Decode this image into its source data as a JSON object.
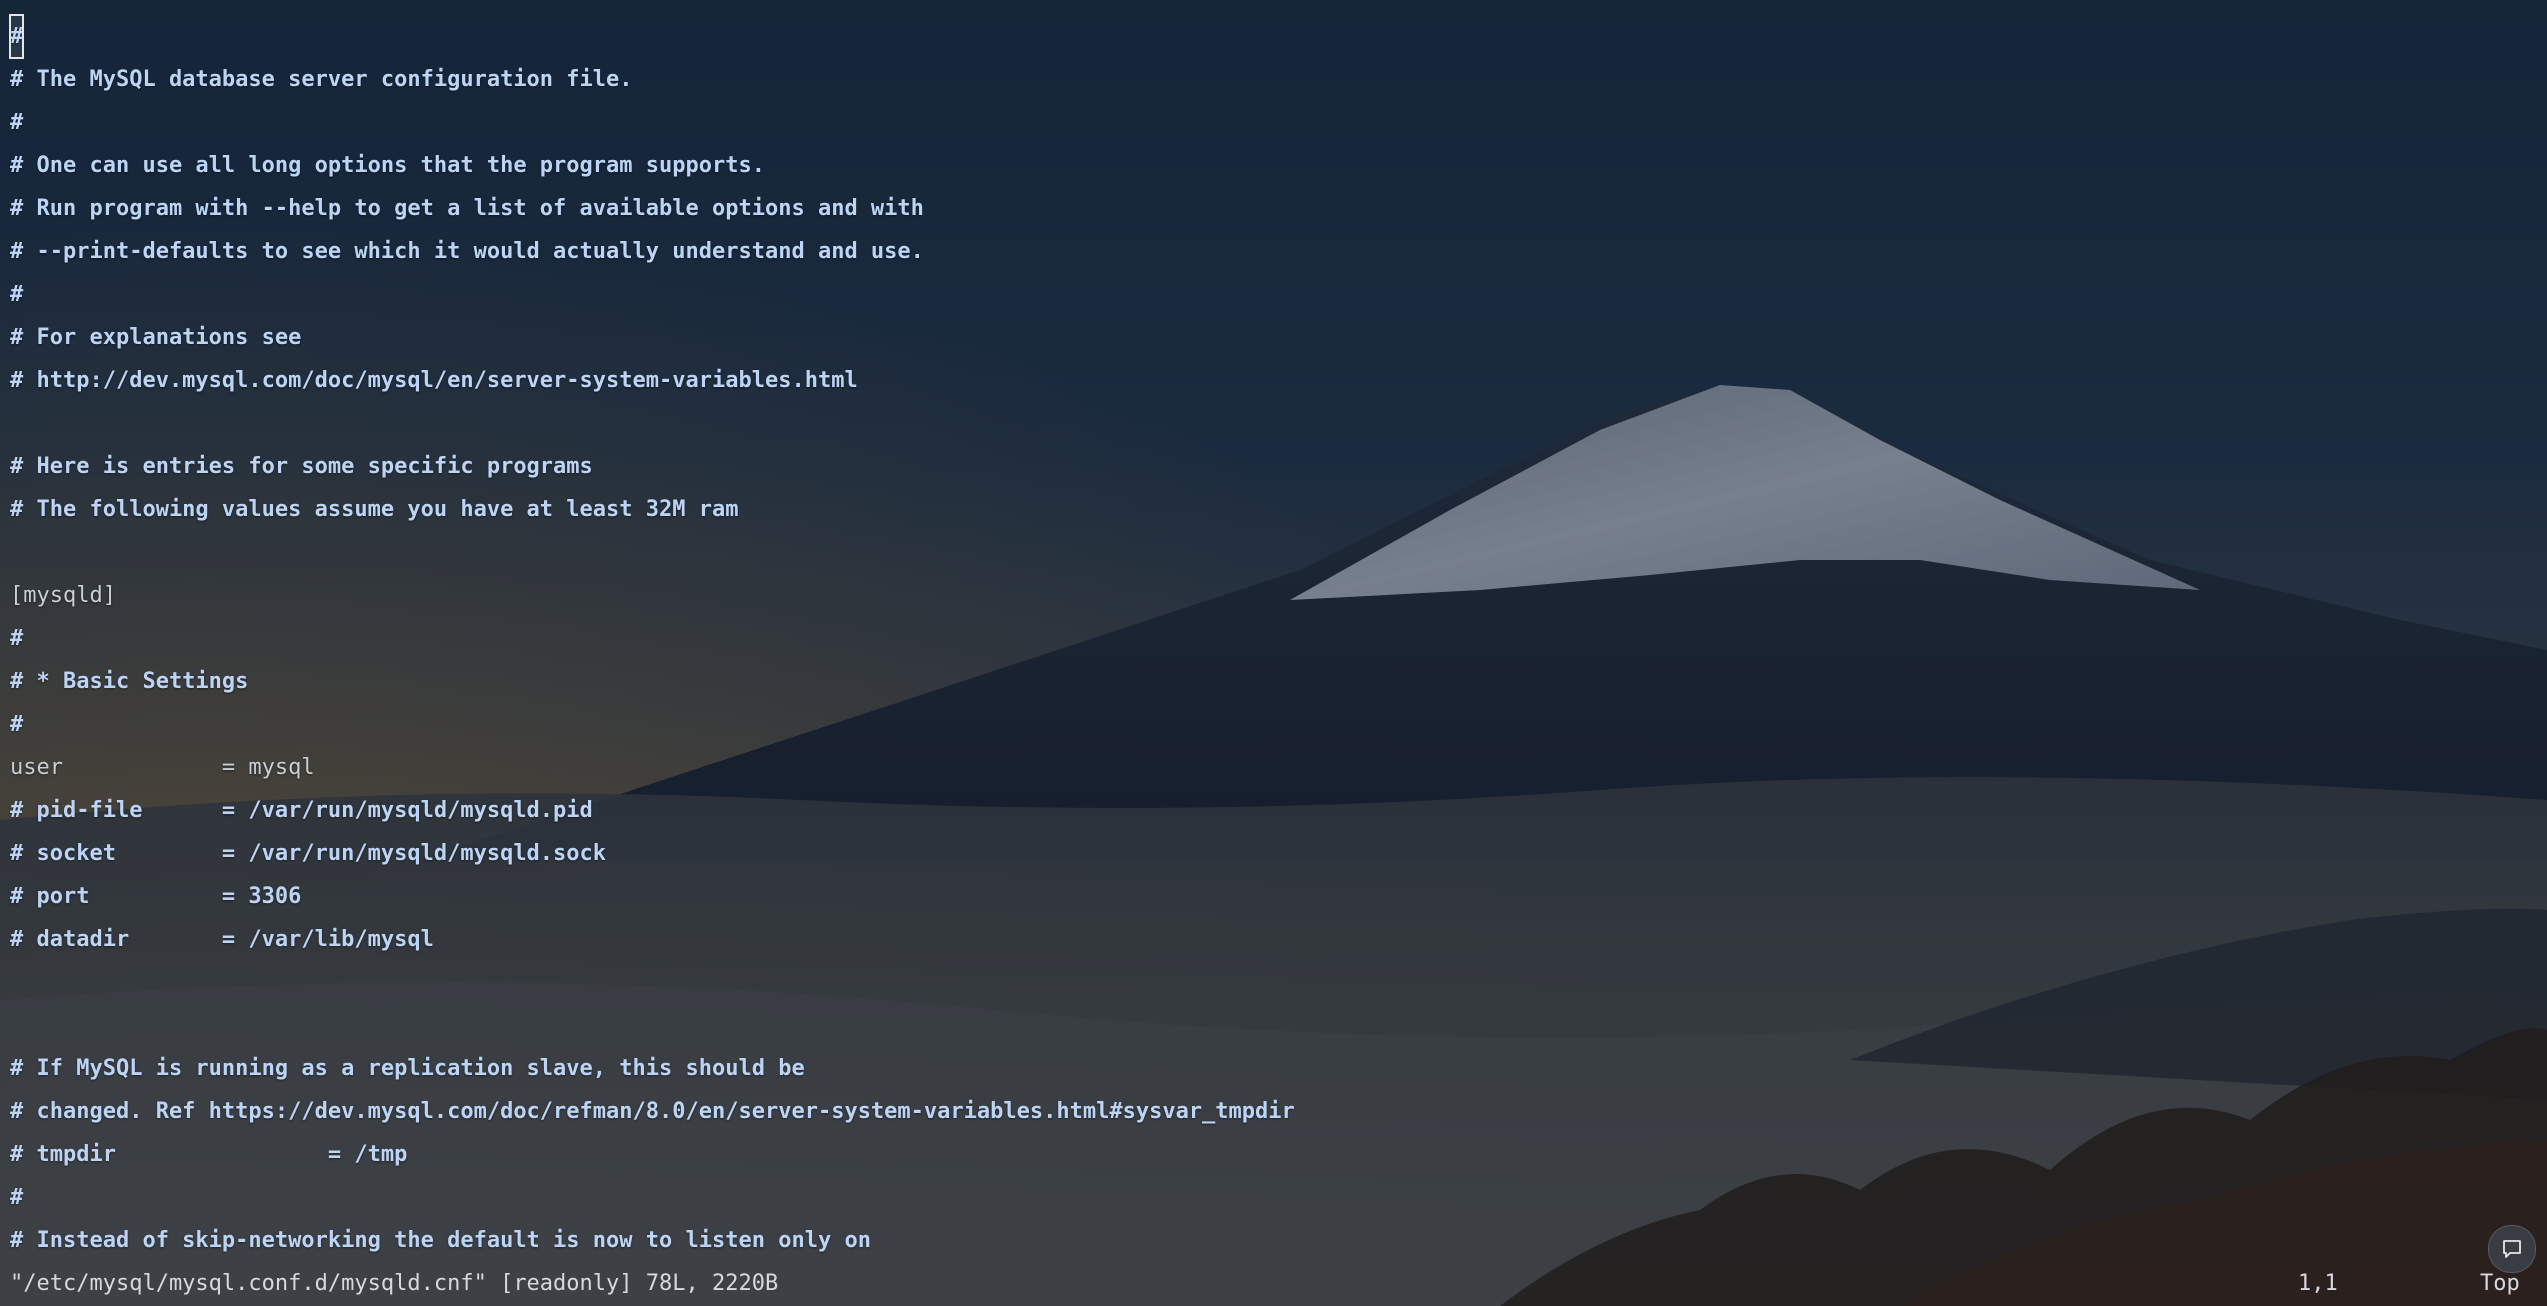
{
  "editor": {
    "lines": [
      {
        "text": "#",
        "kind": "comment"
      },
      {
        "text": "# The MySQL database server configuration file.",
        "kind": "comment"
      },
      {
        "text": "#",
        "kind": "comment"
      },
      {
        "text": "# One can use all long options that the program supports.",
        "kind": "comment"
      },
      {
        "text": "# Run program with --help to get a list of available options and with",
        "kind": "comment"
      },
      {
        "text": "# --print-defaults to see which it would actually understand and use.",
        "kind": "comment"
      },
      {
        "text": "#",
        "kind": "comment"
      },
      {
        "text": "# For explanations see",
        "kind": "comment"
      },
      {
        "text": "# http://dev.mysql.com/doc/mysql/en/server-system-variables.html",
        "kind": "comment"
      },
      {
        "text": "",
        "kind": "plain"
      },
      {
        "text": "# Here is entries for some specific programs",
        "kind": "comment"
      },
      {
        "text": "# The following values assume you have at least 32M ram",
        "kind": "comment"
      },
      {
        "text": "",
        "kind": "plain"
      },
      {
        "text": "[mysqld]",
        "kind": "plain"
      },
      {
        "text": "#",
        "kind": "comment"
      },
      {
        "text": "# * Basic Settings",
        "kind": "comment"
      },
      {
        "text": "#",
        "kind": "comment"
      },
      {
        "text": "user            = mysql",
        "kind": "plain"
      },
      {
        "text": "# pid-file      = /var/run/mysqld/mysqld.pid",
        "kind": "comment"
      },
      {
        "text": "# socket        = /var/run/mysqld/mysqld.sock",
        "kind": "comment"
      },
      {
        "text": "# port          = 3306",
        "kind": "comment"
      },
      {
        "text": "# datadir       = /var/lib/mysql",
        "kind": "comment"
      },
      {
        "text": "",
        "kind": "plain"
      },
      {
        "text": "",
        "kind": "plain"
      },
      {
        "text": "# If MySQL is running as a replication slave, this should be",
        "kind": "comment"
      },
      {
        "text": "# changed. Ref https://dev.mysql.com/doc/refman/8.0/en/server-system-variables.html#sysvar_tmpdir",
        "kind": "comment"
      },
      {
        "text": "# tmpdir                = /tmp",
        "kind": "comment"
      },
      {
        "text": "#",
        "kind": "comment"
      },
      {
        "text": "# Instead of skip-networking the default is now to listen only on",
        "kind": "comment"
      }
    ]
  },
  "status": {
    "file_info": "\"/etc/mysql/mysql.conf.d/mysqld.cnf\" [readonly] 78L, 2220B",
    "cursor_position": "1,1",
    "scroll_position": "Top"
  },
  "icons": {
    "chat": "chat-bubble-icon"
  },
  "colors": {
    "comment": "#bcd4f5",
    "plain": "#c9cdd4",
    "status_text": "#d6d9de"
  }
}
